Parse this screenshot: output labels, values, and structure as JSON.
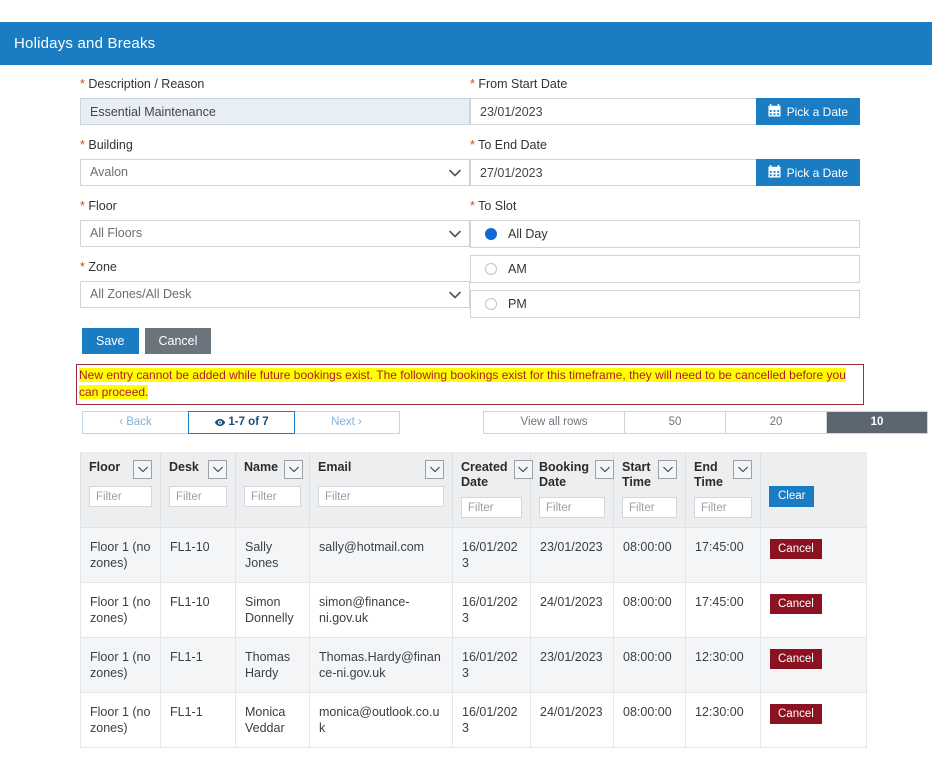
{
  "header": {
    "title": "Holidays and Breaks"
  },
  "form": {
    "description": {
      "label_prefix": "*",
      "label": "Description / Reason",
      "value": "Essential Maintenance",
      "placeholder": ""
    },
    "building": {
      "label_prefix": "*",
      "label": "Building",
      "value": "Avalon"
    },
    "floor": {
      "label_prefix": "*",
      "label": "Floor",
      "value": "All Floors"
    },
    "zone": {
      "label_prefix": "*",
      "label": "Zone",
      "value": "All Zones/All Desk"
    },
    "from_start_date": {
      "label_prefix": "*",
      "label": "From Start Date",
      "value": "23/01/2023",
      "button_label": "Pick a Date"
    },
    "to_end_date": {
      "label_prefix": "*",
      "label": "To End Date",
      "value": "27/01/2023",
      "button_label": "Pick a Date"
    },
    "to_slot": {
      "label_prefix": "*",
      "label": "To Slot",
      "options": [
        {
          "label": "All Day",
          "selected": true
        },
        {
          "label": "AM",
          "selected": false
        },
        {
          "label": "PM",
          "selected": false
        }
      ]
    },
    "save_label": "Save",
    "cancel_label": "Cancel"
  },
  "warning": {
    "message": "New entry cannot be added while future bookings exist. The following bookings exist for this timeframe, they will need to be cancelled before you can proceed.",
    "text_color": "#b01c2e",
    "highlight_color": "#ffff00",
    "border_color": "#9e2b38"
  },
  "pager": {
    "back_label": "Back",
    "count_label": "1-7 of 7",
    "next_label": "Next",
    "rows_options": [
      {
        "label": "View all rows",
        "selected": false
      },
      {
        "label": "50",
        "selected": false
      },
      {
        "label": "20",
        "selected": false
      },
      {
        "label": "10",
        "selected": true
      }
    ]
  },
  "table": {
    "columns": [
      {
        "label": "Floor",
        "filter_placeholder": "Filter"
      },
      {
        "label": "Desk",
        "filter_placeholder": "Filter"
      },
      {
        "label": "Name",
        "filter_placeholder": "Filter"
      },
      {
        "label": "Email",
        "filter_placeholder": "Filter"
      },
      {
        "label": "Created Date",
        "filter_placeholder": "Filter"
      },
      {
        "label": "Booking Date",
        "filter_placeholder": "Filter"
      },
      {
        "label": "Start Time",
        "filter_placeholder": "Filter"
      },
      {
        "label": "End Time",
        "filter_placeholder": "Filter"
      }
    ],
    "clear_label": "Clear",
    "row_action_label": "Cancel",
    "rows": [
      {
        "floor": "Floor 1 (no zones)",
        "desk": "FL1-10",
        "name": "Sally Jones",
        "email": "sally@hotmail.com",
        "created_date": "16/01/2023",
        "booking_date": "23/01/2023",
        "start_time": "08:00:00",
        "end_time": "17:45:00",
        "action": "Cancel"
      },
      {
        "floor": "Floor 1 (no zones)",
        "desk": "FL1-10",
        "name": "Simon Donnelly",
        "email": "simon@finance-ni.gov.uk",
        "created_date": "16/01/2023",
        "booking_date": "24/01/2023",
        "start_time": "08:00:00",
        "end_time": "17:45:00",
        "action": "Cancel"
      },
      {
        "floor": "Floor 1 (no zones)",
        "desk": "FL1-1",
        "name": "Thomas Hardy",
        "email": "Thomas.Hardy@finance-ni.gov.uk",
        "created_date": "16/01/2023",
        "booking_date": "23/01/2023",
        "start_time": "08:00:00",
        "end_time": "12:30:00",
        "action": "Cancel"
      },
      {
        "floor": "Floor 1 (no zones)",
        "desk": "FL1-1",
        "name": "Monica Veddar",
        "email": "monica@outlook.co.uk",
        "created_date": "16/01/2023",
        "booking_date": "24/01/2023",
        "start_time": "08:00:00",
        "end_time": "12:30:00",
        "action": "Cancel"
      }
    ]
  },
  "colors": {
    "brand_blue": "#1a7dc4",
    "danger_red": "#8b1220",
    "grey_button": "#6c757d",
    "selected_grey": "#5b6670"
  }
}
